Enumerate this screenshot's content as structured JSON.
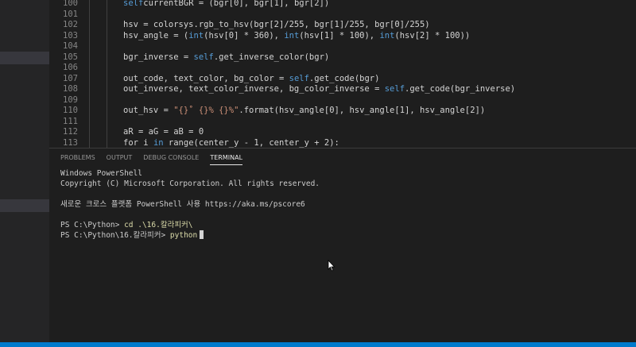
{
  "editor": {
    "lines": [
      {
        "n": "100",
        "parts": [
          [
            "kw",
            "self"
          ],
          [
            "",
            "currentBGR = (bgr[0], bgr[1], bgr[2])"
          ]
        ]
      },
      {
        "n": "101",
        "parts": []
      },
      {
        "n": "102",
        "parts": [
          [
            "",
            "hsv = colorsys.rgb_to_hsv(bgr[2]/255, bgr[1]/255, bgr[0]/255)"
          ]
        ]
      },
      {
        "n": "103",
        "parts": [
          [
            "",
            "hsv_angle = ("
          ],
          [
            "kw",
            "int"
          ],
          [
            "",
            "(hsv[0] * 360), "
          ],
          [
            "kw",
            "int"
          ],
          [
            "",
            "(hsv[1] * 100), "
          ],
          [
            "kw",
            "int"
          ],
          [
            "",
            "(hsv[2] * 100))"
          ]
        ]
      },
      {
        "n": "104",
        "parts": []
      },
      {
        "n": "105",
        "parts": [
          [
            "",
            "bgr_inverse = "
          ],
          [
            "kw",
            "self"
          ],
          [
            "",
            ".get_inverse_color(bgr)"
          ]
        ]
      },
      {
        "n": "106",
        "parts": []
      },
      {
        "n": "107",
        "parts": [
          [
            "",
            "out_code, text_color, bg_color = "
          ],
          [
            "kw",
            "self"
          ],
          [
            "",
            ".get_code(bgr)"
          ]
        ]
      },
      {
        "n": "108",
        "parts": [
          [
            "",
            "out_inverse, text_color_inverse, bg_color_inverse = "
          ],
          [
            "kw",
            "self"
          ],
          [
            "",
            ".get_code(bgr_inverse)"
          ]
        ]
      },
      {
        "n": "109",
        "parts": []
      },
      {
        "n": "110",
        "parts": [
          [
            "",
            "out_hsv = "
          ],
          [
            "str",
            "\"{}˚ {}% {}%\""
          ],
          [
            "",
            ".format(hsv_angle[0], hsv_angle[1], hsv_angle[2])"
          ]
        ]
      },
      {
        "n": "111",
        "parts": []
      },
      {
        "n": "112",
        "parts": [
          [
            "",
            "aR = aG = aB = 0"
          ]
        ]
      },
      {
        "n": "113",
        "parts": [
          [
            "",
            "for i "
          ],
          [
            "kw",
            "in"
          ],
          [
            "",
            " range(center_y - 1, center_y + 2):"
          ]
        ]
      }
    ]
  },
  "panel": {
    "tabs": [
      "PROBLEMS",
      "OUTPUT",
      "DEBUG CONSOLE",
      "TERMINAL"
    ],
    "terminal": {
      "l1": "Windows PowerShell",
      "l2": "Copyright (C) Microsoft Corporation. All rights reserved.",
      "l3": "새로운 크로스 플랫폼 PowerShell 사용 https://aka.ms/pscore6",
      "p1": "PS C:\\Python> ",
      "c1": "cd .\\16.칼라피커\\",
      "p2": "PS C:\\Python\\16.칼라피커> ",
      "c2": "python"
    }
  },
  "colors": {
    "status_bar": "#007acc",
    "keyword": "#569cd6",
    "string": "#ce9178"
  }
}
